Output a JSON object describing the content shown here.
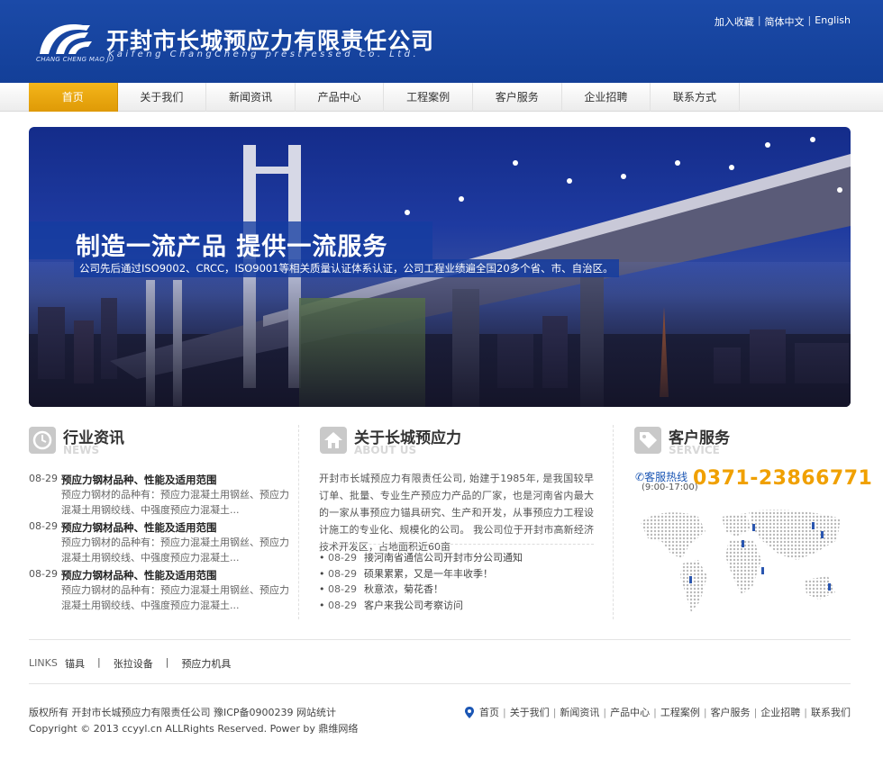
{
  "header": {
    "company_cn": "开封市长城预应力有限责任公司",
    "company_en": "Kaifeng ChangCheng prestressed Co. Ltd.",
    "logo_text": "CHANG CHENG MAO JU",
    "top_links": [
      "加入收藏",
      "简体中文",
      "English"
    ]
  },
  "nav": {
    "items": [
      "首页",
      "关于我们",
      "新闻资讯",
      "产品中心",
      "工程案例",
      "客户服务",
      "企业招聘",
      "联系方式"
    ],
    "active": "首页"
  },
  "banner": {
    "headline": "制造一流产品 提供一流服务",
    "subline": "公司先后通过ISO9002、CRCC，ISO9001等相关质量认证体系认证，公司工程业绩遍全国20多个省、市、自治区。"
  },
  "news": {
    "title_cn": "行业资讯",
    "title_en": "NEWS",
    "items": [
      {
        "date": "08-29",
        "title": "预应力钢材品种、性能及适用范围",
        "desc": "预应力钢材的品种有：预应力混凝土用钢丝、预应力混凝土用钢绞线、中强度预应力混凝土..."
      },
      {
        "date": "08-29",
        "title": "预应力钢材品种、性能及适用范围",
        "desc": "预应力钢材的品种有：预应力混凝土用钢丝、预应力混凝土用钢绞线、中强度预应力混凝土..."
      },
      {
        "date": "08-29",
        "title": "预应力钢材品种、性能及适用范围",
        "desc": "预应力钢材的品种有：预应力混凝土用钢丝、预应力混凝土用钢绞线、中强度预应力混凝土..."
      }
    ]
  },
  "about": {
    "title_cn": "关于长城预应力",
    "title_en": "ABOUT US",
    "text": "开封市长城预应力有限责任公司, 始建于1985年, 是我国较早订单、批量、专业生产预应力产品的厂家，也是河南省内最大的一家从事预应力锚具研究、生产和开发，从事预应力工程设计施工的专业化、规模化的公司。 我公司位于开封市高新经济技术开发区，占地面积近60亩",
    "list": [
      {
        "date": "08-29",
        "title": "接河南省通信公司开封市分公司通知"
      },
      {
        "date": "08-29",
        "title": "硕果累累，又是一年丰收季！"
      },
      {
        "date": "08-29",
        "title": "秋意浓，菊花香！"
      },
      {
        "date": "08-29",
        "title": "客户来我公司考察访问"
      }
    ]
  },
  "service": {
    "title_cn": "客户服务",
    "title_en": "SERVICE",
    "hotline_label": "客服热线",
    "hotline_hours": "(9:00-17:00)",
    "hotline_number": "0371-23866771"
  },
  "links": {
    "label": "LINKS",
    "items": [
      "锚具",
      "张拉设备",
      "预应力机具"
    ]
  },
  "footer": {
    "copyright_line1": "版权所有 开封市长城预应力有限责任公司 豫ICP备0900239 网站统计",
    "copyright_line2": "Copyright © 2013 ccyyl.cn ALLRights Reserved. Power by 鼎维网络",
    "nav": [
      "首页",
      "关于我们",
      "新闻资讯",
      "产品中心",
      "工程案例",
      "客户服务",
      "企业招聘",
      "联系我们"
    ]
  },
  "colors": {
    "header_blue": "#1b4aa8",
    "active_orange": "#f4b51a",
    "hotline_orange": "#f0a000",
    "link_blue": "#1b56b4"
  }
}
